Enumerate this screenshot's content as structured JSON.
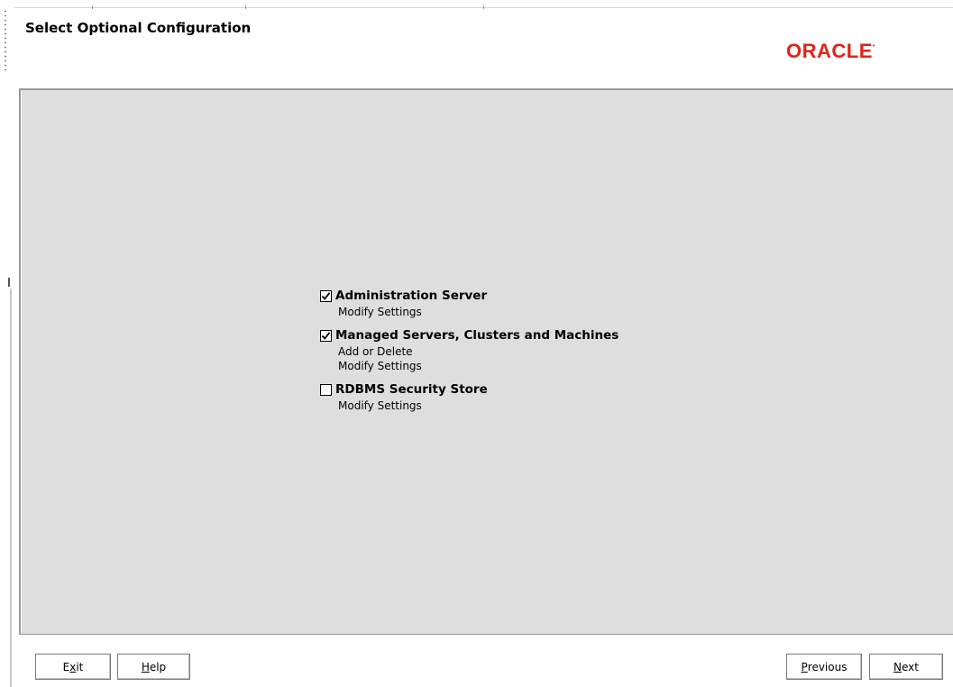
{
  "header": {
    "title": "Select Optional Configuration",
    "logo_text": "ORACLE",
    "logo_color": "#e2231a"
  },
  "options": [
    {
      "label": "Administration Server",
      "checked": true,
      "sub_items": [
        "Modify Settings"
      ]
    },
    {
      "label": "Managed Servers, Clusters and Machines",
      "checked": true,
      "sub_items": [
        "Add or Delete",
        "Modify Settings"
      ]
    },
    {
      "label": "RDBMS Security Store",
      "checked": false,
      "sub_items": [
        "Modify Settings"
      ]
    }
  ],
  "footer": {
    "exit": {
      "mnemonic": "x",
      "before": "E",
      "after": "it"
    },
    "help": {
      "mnemonic": "H",
      "before": "",
      "after": "elp"
    },
    "previous": {
      "mnemonic": "P",
      "before": "",
      "after": "revious"
    },
    "next": {
      "mnemonic": "N",
      "before": "",
      "after": "ext"
    }
  }
}
